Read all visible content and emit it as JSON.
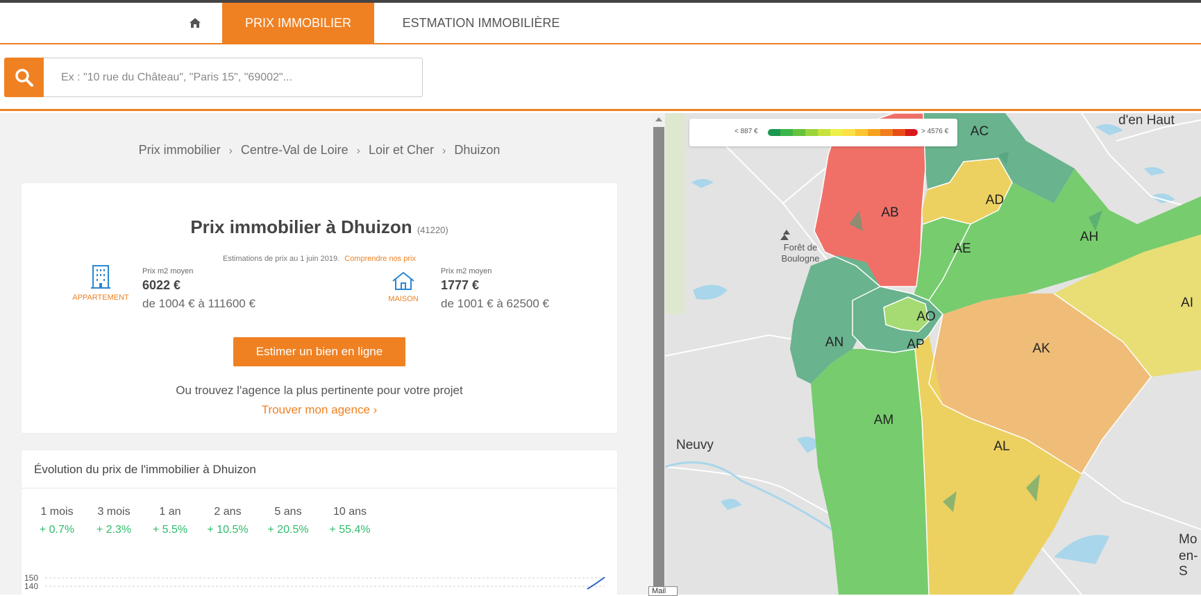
{
  "nav": {
    "home_icon": "home-icon",
    "tabs": [
      {
        "label": "PRIX IMMOBILIER",
        "active": true
      },
      {
        "label": "ESTMATION IMMOBILIÈRE",
        "active": false
      }
    ]
  },
  "search": {
    "icon": "search-icon",
    "placeholder": "Ex : \"10 rue du Château\", \"Paris 15\", \"69002\"..."
  },
  "breadcrumb": [
    "Prix immobilier",
    "Centre-Val de Loire",
    "Loir et Cher",
    "Dhuizon"
  ],
  "summary": {
    "title": "Prix immobilier à Dhuizon",
    "postal_code": "(41220)",
    "estimation_note": "Estimations de prix au 1 juin 2019.",
    "estimation_link": "Comprendre nos prix",
    "appartement": {
      "type_label": "APPARTEMENT",
      "icon": "building-icon",
      "price_label": "Prix m2 moyen",
      "price": "6022 €",
      "range": "de 1004 € à 111600 €"
    },
    "maison": {
      "type_label": "MAISON",
      "icon": "house-icon",
      "price_label": "Prix m2 moyen",
      "price": "1777 €",
      "range": "de 1001 € à 62500 €"
    },
    "estimate_button": "Estimer un bien en ligne",
    "agency_text": "Ou trouvez l'agence la plus pertinente pour votre projet",
    "agency_link": "Trouver mon agence ›"
  },
  "evolution": {
    "title": "Évolution du prix de l'immobilier à Dhuizon",
    "periods": [
      {
        "period": "1 mois",
        "value": "+ 0.7%"
      },
      {
        "period": "3 mois",
        "value": "+ 2.3%"
      },
      {
        "period": "1 an",
        "value": "+ 5.5%"
      },
      {
        "period": "2 ans",
        "value": "+ 10.5%"
      },
      {
        "period": "5 ans",
        "value": "+ 20.5%"
      },
      {
        "period": "10 ans",
        "value": "+ 55.4%"
      }
    ],
    "chart_ticks": [
      "150",
      "140"
    ]
  },
  "map": {
    "legend_min": "< 887 €",
    "legend_max": "> 4576 €",
    "legend_colors": [
      "#1a9850",
      "#3cb54a",
      "#66c23a",
      "#9bd33a",
      "#c7e23e",
      "#eef04a",
      "#fde047",
      "#fbc531",
      "#f7a21f",
      "#f07e1b",
      "#e84d16",
      "#d7191c"
    ],
    "zones": [
      "AC",
      "AB",
      "AD",
      "AE",
      "AH",
      "AI",
      "AO",
      "AN",
      "AP",
      "AK",
      "AM",
      "AL"
    ],
    "places": [
      "d'en Haut",
      "Neuvy",
      "Mo",
      "en-S"
    ],
    "forest": "Forêt de Boulogne"
  },
  "mail_tag": "Mail"
}
